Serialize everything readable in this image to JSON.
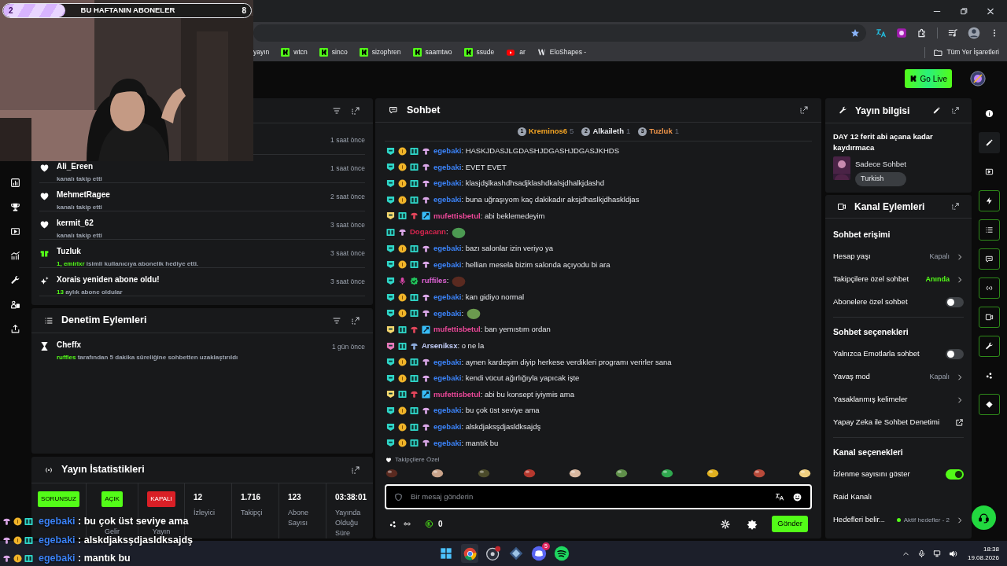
{
  "overlay": {
    "sub_goal": {
      "current": "2",
      "title": "BU HAFTANIN ABONELER",
      "target": "8",
      "level": 0.25
    },
    "chat_lines": [
      {
        "user": "egebaki",
        "color": "#3b82f6",
        "text": ": bu çok üst seviye ama"
      },
      {
        "user": "egebaki",
        "color": "#3b82f6",
        "text": ": alskdjaksşdjasldksajdş"
      },
      {
        "user": "egebaki",
        "color": "#3b82f6",
        "text": ": mantık bu"
      }
    ]
  },
  "browser": {
    "bookmarks": [
      {
        "label": "yayın"
      },
      {
        "kind": "kick",
        "label": "wtcn"
      },
      {
        "kind": "kick",
        "label": "sinco"
      },
      {
        "kind": "kick",
        "label": "sizophren"
      },
      {
        "kind": "kick",
        "label": "saamtwo"
      },
      {
        "kind": "kick",
        "label": "ssude"
      },
      {
        "kind": "youtube",
        "label": "ar"
      },
      {
        "kind": "eloshapes",
        "label": "EloShapes -"
      }
    ],
    "all_bookmarks": "Tüm Yer İşaretleri"
  },
  "topbar": {
    "go_live": "Go Live"
  },
  "activity": {
    "events": [
      {
        "time": "1 saat önce"
      },
      {
        "kind": "follow",
        "name": "Ali_Ereen",
        "detail": "kanalı takip etti",
        "time": "1 saat önce"
      },
      {
        "kind": "follow",
        "name": "MehmetRagee",
        "detail": "kanalı takip etti",
        "time": "2 saat önce"
      },
      {
        "kind": "follow",
        "name": "kermit_62",
        "detail": "kanalı takip etti",
        "time": "3 saat önce"
      },
      {
        "kind": "gift",
        "name": "Tuzluk",
        "highlight": "1, emirlxr",
        "detail": "isimli kullanıcıya abonelik hediye etti.",
        "time": "3 saat önce"
      },
      {
        "kind": "resub",
        "name": "Xorais yeniden abone oldu!",
        "highlight": "13",
        "detail": "aylık abone oldular",
        "time": "3 saat önce"
      }
    ]
  },
  "moderation": {
    "title": "Denetim Eylemleri",
    "events": [
      {
        "kind": "timeout",
        "name": "Cheffx",
        "highlight": "ruffles",
        "detail": "tarafından 5 dakika süreliğine sohbetten uzaklaştırıldı",
        "time": "1 gün önce"
      }
    ]
  },
  "stats": {
    "title": "Yayın İstatistikleri",
    "badges": [
      {
        "label": "SORUNSUZ",
        "color": "#53fc18"
      },
      {
        "label": "AÇIK",
        "color": "#53fc18",
        "caption": "Gelir"
      },
      {
        "label": "KAPALI",
        "color": "#d91f26",
        "caption": "Yayın"
      }
    ],
    "values": [
      {
        "value": "12",
        "label": "İzleyici"
      },
      {
        "value": "1.716",
        "label": "Takipçi"
      },
      {
        "value": "123",
        "label": "Abone Sayısı"
      },
      {
        "value": "03:38:01",
        "label": "Yayında Olduğu Süre"
      }
    ]
  },
  "chat": {
    "title": "Sohbet",
    "gifters": [
      {
        "rank": "1",
        "name": "Kreminos6",
        "count": "5",
        "color": "#f5a524"
      },
      {
        "rank": "2",
        "name": "Alkaileth",
        "count": "1",
        "color": "#e5e7eb"
      },
      {
        "rank": "3",
        "name": "Tuzluk",
        "count": "1",
        "color": "#f0954a"
      }
    ],
    "messages": [
      {
        "kind": "text",
        "user": "egebaki",
        "color": "#3b82f6",
        "badges": [
          {
            "kind": "subscriber",
            "color": "#2fd6c8"
          },
          {
            "kind": "gifter",
            "color": "#f0b429"
          },
          {
            "kind": "og",
            "color": "#2fd6c8"
          },
          {
            "kind": "cosmetic",
            "color": "#d9a6e6"
          }
        ],
        "text": ": HASKJDASJLGDASHJDGASHJDGASJKHDS"
      },
      {
        "kind": "text",
        "user": "egebaki",
        "color": "#3b82f6",
        "badges": [
          {
            "kind": "subscriber",
            "color": "#2fd6c8"
          },
          {
            "kind": "gifter",
            "color": "#f0b429"
          },
          {
            "kind": "og",
            "color": "#2fd6c8"
          },
          {
            "kind": "cosmetic",
            "color": "#d9a6e6"
          }
        ],
        "text": ": EVET EVET"
      },
      {
        "kind": "text",
        "user": "egebaki",
        "color": "#3b82f6",
        "badges": [
          {
            "kind": "subscriber",
            "color": "#2fd6c8"
          },
          {
            "kind": "gifter",
            "color": "#f0b429"
          },
          {
            "kind": "og",
            "color": "#2fd6c8"
          },
          {
            "kind": "cosmetic",
            "color": "#d9a6e6"
          }
        ],
        "text": ": klasjdşlkashdhsadjklashdkalsjdhalkjdashd"
      },
      {
        "kind": "text",
        "user": "egebaki",
        "color": "#3b82f6",
        "badges": [
          {
            "kind": "subscriber",
            "color": "#2fd6c8"
          },
          {
            "kind": "gifter",
            "color": "#f0b429"
          },
          {
            "kind": "og",
            "color": "#2fd6c8"
          },
          {
            "kind": "cosmetic",
            "color": "#d9a6e6"
          }
        ],
        "text": ": buna uğraşıyom kaç dakikadır aksjdhaslkjdhaskldjas"
      },
      {
        "kind": "text",
        "user": "mufettisbetul",
        "color": "#ec4899",
        "badges": [
          {
            "kind": "subscriber",
            "color": "#f5d76e"
          },
          {
            "kind": "og",
            "color": "#2fd6c8"
          },
          {
            "kind": "cosmetic",
            "color": "#e0455a"
          },
          {
            "kind": "moderator",
            "color": "#38bdf8"
          }
        ],
        "text": ": abi beklemedeyim"
      },
      {
        "kind": "emote",
        "user": "Dogacann",
        "color": "#d9254f",
        "badges": [
          {
            "kind": "og",
            "color": "#2fd6c8"
          },
          {
            "kind": "cosmetic",
            "color": "#d9a6e6"
          }
        ],
        "text": ":",
        "emote": {
          "color": "#4c9a52"
        }
      },
      {
        "kind": "text",
        "user": "egebaki",
        "color": "#3b82f6",
        "badges": [
          {
            "kind": "subscriber",
            "color": "#2fd6c8"
          },
          {
            "kind": "gifter",
            "color": "#f0b429"
          },
          {
            "kind": "og",
            "color": "#2fd6c8"
          },
          {
            "kind": "cosmetic",
            "color": "#d9a6e6"
          }
        ],
        "text": ": bazı salonlar izin veriyo ya"
      },
      {
        "kind": "text",
        "user": "egebaki",
        "color": "#3b82f6",
        "badges": [
          {
            "kind": "subscriber",
            "color": "#2fd6c8"
          },
          {
            "kind": "gifter",
            "color": "#f0b429"
          },
          {
            "kind": "og",
            "color": "#2fd6c8"
          },
          {
            "kind": "cosmetic",
            "color": "#d9a6e6"
          }
        ],
        "text": ": hellian mesela bizim salonda açıyodu bi ara"
      },
      {
        "kind": "emote",
        "user": "ruffiles",
        "color": "#e063d6",
        "badges": [
          {
            "kind": "subscriber",
            "color": "#2fd6c8"
          },
          {
            "kind": "broadcaster",
            "color": "#d946a8"
          },
          {
            "kind": "verified",
            "color": "#22c55e"
          }
        ],
        "text": ":",
        "emote": {
          "color": "#5a2a20"
        }
      },
      {
        "kind": "text",
        "user": "egebaki",
        "color": "#3b82f6",
        "badges": [
          {
            "kind": "subscriber",
            "color": "#2fd6c8"
          },
          {
            "kind": "gifter",
            "color": "#f0b429"
          },
          {
            "kind": "og",
            "color": "#2fd6c8"
          },
          {
            "kind": "cosmetic",
            "color": "#d9a6e6"
          }
        ],
        "text": ": kan gidiyo normal"
      },
      {
        "kind": "emote",
        "user": "egebaki",
        "color": "#3b82f6",
        "badges": [
          {
            "kind": "subscriber",
            "color": "#2fd6c8"
          },
          {
            "kind": "gifter",
            "color": "#f0b429"
          },
          {
            "kind": "og",
            "color": "#2fd6c8"
          },
          {
            "kind": "cosmetic",
            "color": "#d9a6e6"
          }
        ],
        "text": ":",
        "emote": {
          "color": "#6b9a4e"
        }
      },
      {
        "kind": "text",
        "user": "mufettisbetul",
        "color": "#ec4899",
        "badges": [
          {
            "kind": "subscriber",
            "color": "#f5d76e"
          },
          {
            "kind": "og",
            "color": "#2fd6c8"
          },
          {
            "kind": "cosmetic",
            "color": "#e0455a"
          },
          {
            "kind": "moderator",
            "color": "#38bdf8"
          }
        ],
        "text": ": ban yemıstım ordan"
      },
      {
        "kind": "text",
        "user": "Arseniksx",
        "color": "#c7d2fe",
        "badges": [
          {
            "kind": "subscriber",
            "color": "#e879b9"
          },
          {
            "kind": "og",
            "color": "#2fd6c8"
          },
          {
            "kind": "cosmetic",
            "color": "#8aa8d8"
          }
        ],
        "text": ": o ne la"
      },
      {
        "kind": "text",
        "user": "egebaki",
        "color": "#3b82f6",
        "badges": [
          {
            "kind": "subscriber",
            "color": "#2fd6c8"
          },
          {
            "kind": "gifter",
            "color": "#f0b429"
          },
          {
            "kind": "og",
            "color": "#2fd6c8"
          },
          {
            "kind": "cosmetic",
            "color": "#d9a6e6"
          }
        ],
        "text": ": aynen kardeşim diyip herkese verdikleri programı verirler sana"
      },
      {
        "kind": "text",
        "user": "egebaki",
        "color": "#3b82f6",
        "badges": [
          {
            "kind": "subscriber",
            "color": "#2fd6c8"
          },
          {
            "kind": "gifter",
            "color": "#f0b429"
          },
          {
            "kind": "og",
            "color": "#2fd6c8"
          },
          {
            "kind": "cosmetic",
            "color": "#d9a6e6"
          }
        ],
        "text": ": kendi vücut ağırlığıyla yapıcak işte"
      },
      {
        "kind": "text",
        "user": "mufettisbetul",
        "color": "#ec4899",
        "badges": [
          {
            "kind": "subscriber",
            "color": "#f5d76e"
          },
          {
            "kind": "og",
            "color": "#2fd6c8"
          },
          {
            "kind": "cosmetic",
            "color": "#e0455a"
          },
          {
            "kind": "moderator",
            "color": "#38bdf8"
          }
        ],
        "text": ": abi bu konsept iyiymis ama"
      },
      {
        "kind": "text",
        "user": "egebaki",
        "color": "#3b82f6",
        "badges": [
          {
            "kind": "subscriber",
            "color": "#2fd6c8"
          },
          {
            "kind": "gifter",
            "color": "#f0b429"
          },
          {
            "kind": "og",
            "color": "#2fd6c8"
          },
          {
            "kind": "cosmetic",
            "color": "#d9a6e6"
          }
        ],
        "text": ": bu çok üst seviye ama"
      },
      {
        "kind": "text",
        "user": "egebaki",
        "color": "#3b82f6",
        "badges": [
          {
            "kind": "subscriber",
            "color": "#2fd6c8"
          },
          {
            "kind": "gifter",
            "color": "#f0b429"
          },
          {
            "kind": "og",
            "color": "#2fd6c8"
          },
          {
            "kind": "cosmetic",
            "color": "#d9a6e6"
          }
        ],
        "text": ": alskdjaksşdjasldksajdş"
      },
      {
        "kind": "text",
        "user": "egebaki",
        "color": "#3b82f6",
        "badges": [
          {
            "kind": "subscriber",
            "color": "#2fd6c8"
          },
          {
            "kind": "gifter",
            "color": "#f0b429"
          },
          {
            "kind": "og",
            "color": "#2fd6c8"
          },
          {
            "kind": "cosmetic",
            "color": "#d9a6e6"
          }
        ],
        "text": ": mantık bu"
      }
    ],
    "emote_set": "Takipçilere Özel",
    "placeholder": "Bir mesaj gönderin",
    "points": "0",
    "send": "Gönder"
  },
  "stream_info": {
    "title": "Yayın bilgisi",
    "stream_title": "DAY 12 ferit abi açana kadar kaydırmaca",
    "category": "Sadece Sohbet",
    "tag": "Turkish"
  },
  "channel_actions": {
    "title": "Kanal Eylemleri",
    "sections": [
      {
        "title": "Sohbet erişimi",
        "items": [
          {
            "kind": "link",
            "label": "Hesap yaşı",
            "value": "Kapalı",
            "highlighted": false
          },
          {
            "kind": "link",
            "label": "Takipçilere özel sohbet",
            "value": "Anında",
            "highlighted": true
          },
          {
            "kind": "toggle",
            "label": "Abonelere özel sohbet",
            "on": false
          }
        ]
      },
      {
        "title": "Sohbet seçenekleri",
        "items": [
          {
            "kind": "toggle",
            "label": "Yalnızca Emotlarla sohbet",
            "on": false
          },
          {
            "kind": "link",
            "label": "Yavaş mod",
            "value": "Kapalı",
            "highlighted": false
          },
          {
            "kind": "link",
            "label": "Yasaklanmış kelimeler"
          },
          {
            "kind": "external",
            "label": "Yapay Zeka ile Sohbet Denetimi"
          }
        ]
      },
      {
        "title": "Kanal seçenekleri",
        "items": [
          {
            "kind": "toggle",
            "label": "İzlenme sayısını göster",
            "on": true
          },
          {
            "kind": "plain",
            "label": "Raid Kanalı"
          },
          {
            "kind": "goal",
            "label": "Hedefleri belir...",
            "value": "Aktif hedefler - 2"
          }
        ]
      }
    ]
  },
  "taskbar": {
    "discord_badge": "5",
    "time": "18:38",
    "date": "19.08.2026"
  }
}
